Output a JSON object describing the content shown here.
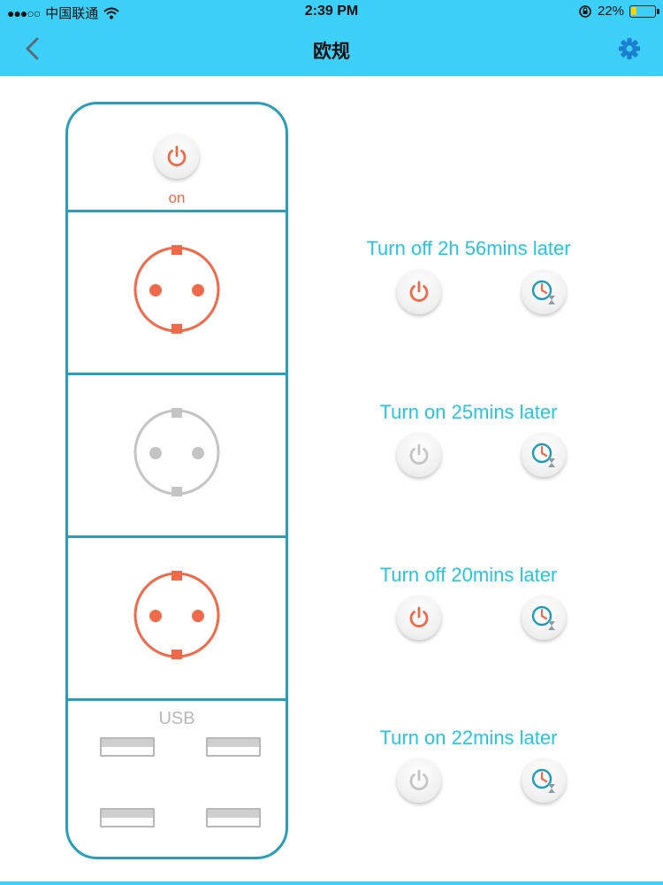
{
  "status_bar": {
    "signal_dots": "●●●○○",
    "carrier": "中国联通",
    "time": "2:39 PM",
    "battery_percent": "22%",
    "battery_level": 0.22
  },
  "nav": {
    "title": "欧规"
  },
  "colors": {
    "header": "#3ccff7",
    "accent_orange": "#f06a4a",
    "inactive_gray": "#c4c4c4",
    "status_text": "#27c3df",
    "strip_border": "#2a9db9"
  },
  "strip": {
    "master_label": "on",
    "usb_label": "USB"
  },
  "outlets": [
    {
      "state": "on",
      "status_text": "Turn off 2h 56mins later"
    },
    {
      "state": "off",
      "status_text": "Turn on 25mins later"
    },
    {
      "state": "on",
      "status_text": "Turn off 20mins later"
    },
    {
      "state": "off",
      "status_text": "Turn on 22mins later"
    }
  ]
}
